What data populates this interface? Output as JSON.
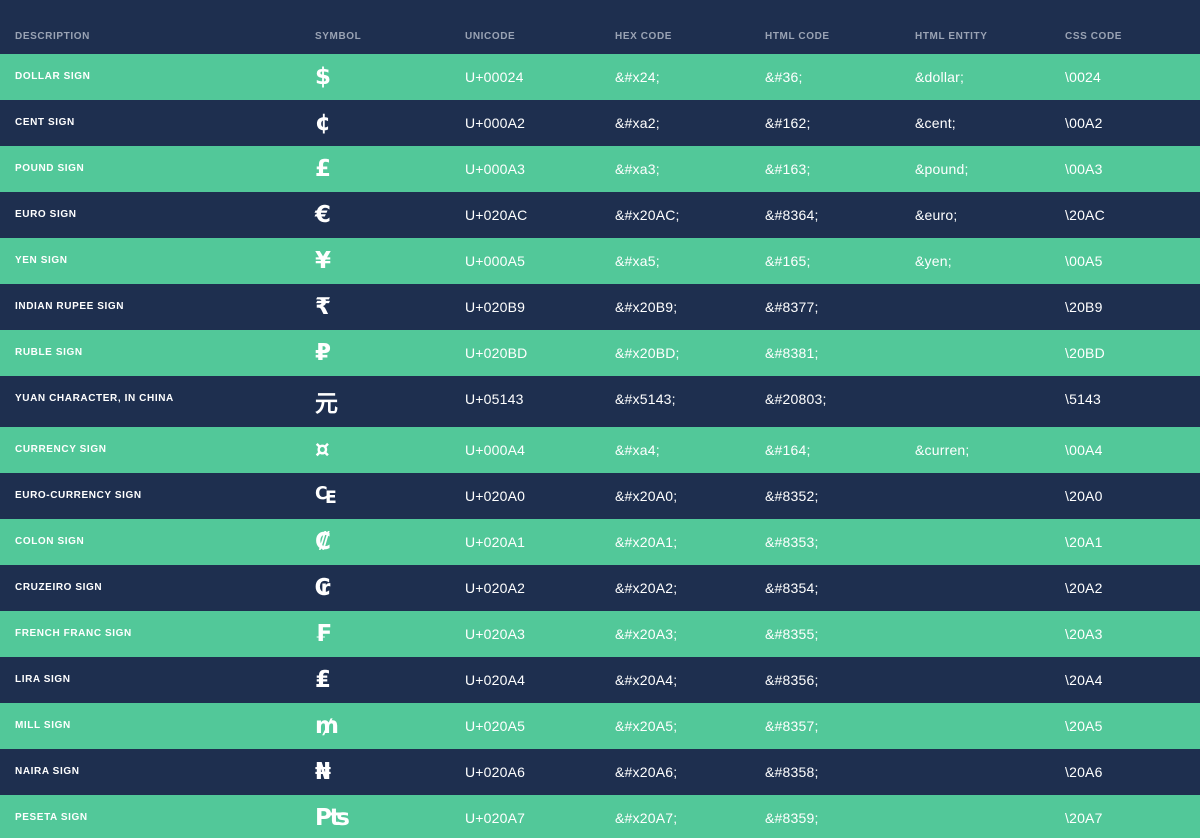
{
  "headers": [
    "DESCRIPTION",
    "SYMBOL",
    "UNICODE",
    "HEX CODE",
    "HTML CODE",
    "HTML ENTITY",
    "CSS CODE"
  ],
  "rows": [
    {
      "description": "DOLLAR SIGN",
      "symbol": "$",
      "unicode": "U+00024",
      "hex": "&#x24;",
      "html": "&#36;",
      "entity": "&dollar;",
      "css": "\\0024"
    },
    {
      "description": "CENT SIGN",
      "symbol": "¢",
      "unicode": "U+000A2",
      "hex": "&#xa2;",
      "html": "&#162;",
      "entity": "&cent;",
      "css": "\\00A2"
    },
    {
      "description": "POUND SIGN",
      "symbol": "£",
      "unicode": "U+000A3",
      "hex": "&#xa3;",
      "html": "&#163;",
      "entity": "&pound;",
      "css": "\\00A3"
    },
    {
      "description": "EURO SIGN",
      "symbol": "€",
      "unicode": "U+020AC",
      "hex": "&#x20AC;",
      "html": "&#8364;",
      "entity": "&euro;",
      "css": "\\20AC"
    },
    {
      "description": "YEN SIGN",
      "symbol": "¥",
      "unicode": "U+000A5",
      "hex": "&#xa5;",
      "html": "&#165;",
      "entity": "&yen;",
      "css": "\\00A5"
    },
    {
      "description": "INDIAN RUPEE SIGN",
      "symbol": "₹",
      "unicode": "U+020B9",
      "hex": "&#x20B9;",
      "html": "&#8377;",
      "entity": "",
      "css": "\\20B9"
    },
    {
      "description": "RUBLE SIGN",
      "symbol": "₽",
      "unicode": "U+020BD",
      "hex": "&#x20BD;",
      "html": "&#8381;",
      "entity": "",
      "css": "\\20BD"
    },
    {
      "description": "YUAN CHARACTER, IN CHINA",
      "symbol": "元",
      "unicode": "U+05143",
      "hex": "&#x5143;",
      "html": "&#20803;",
      "entity": "",
      "css": "\\5143"
    },
    {
      "description": "CURRENCY SIGN",
      "symbol": "¤",
      "unicode": "U+000A4",
      "hex": "&#xa4;",
      "html": "&#164;",
      "entity": "&curren;",
      "css": "\\00A4"
    },
    {
      "description": "EURO-CURRENCY SIGN",
      "symbol": "₠",
      "unicode": "U+020A0",
      "hex": "&#x20A0;",
      "html": "&#8352;",
      "entity": "",
      "css": "\\20A0"
    },
    {
      "description": "COLON SIGN",
      "symbol": "₡",
      "unicode": "U+020A1",
      "hex": "&#x20A1;",
      "html": "&#8353;",
      "entity": "",
      "css": "\\20A1"
    },
    {
      "description": "CRUZEIRO SIGN",
      "symbol": "₢",
      "unicode": "U+020A2",
      "hex": "&#x20A2;",
      "html": "&#8354;",
      "entity": "",
      "css": "\\20A2"
    },
    {
      "description": "FRENCH FRANC SIGN",
      "symbol": "₣",
      "unicode": "U+020A3",
      "hex": "&#x20A3;",
      "html": "&#8355;",
      "entity": "",
      "css": "\\20A3"
    },
    {
      "description": "LIRA SIGN",
      "symbol": "₤",
      "unicode": "U+020A4",
      "hex": "&#x20A4;",
      "html": "&#8356;",
      "entity": "",
      "css": "\\20A4"
    },
    {
      "description": "MILL SIGN",
      "symbol": "₥",
      "unicode": "U+020A5",
      "hex": "&#x20A5;",
      "html": "&#8357;",
      "entity": "",
      "css": "\\20A5"
    },
    {
      "description": "NAIRA SIGN",
      "symbol": "₦",
      "unicode": "U+020A6",
      "hex": "&#x20A6;",
      "html": "&#8358;",
      "entity": "",
      "css": "\\20A6"
    },
    {
      "description": "PESETA SIGN",
      "symbol": "₧",
      "unicode": "U+020A7",
      "hex": "&#x20A7;",
      "html": "&#8359;",
      "entity": "",
      "css": "\\20A7"
    }
  ]
}
